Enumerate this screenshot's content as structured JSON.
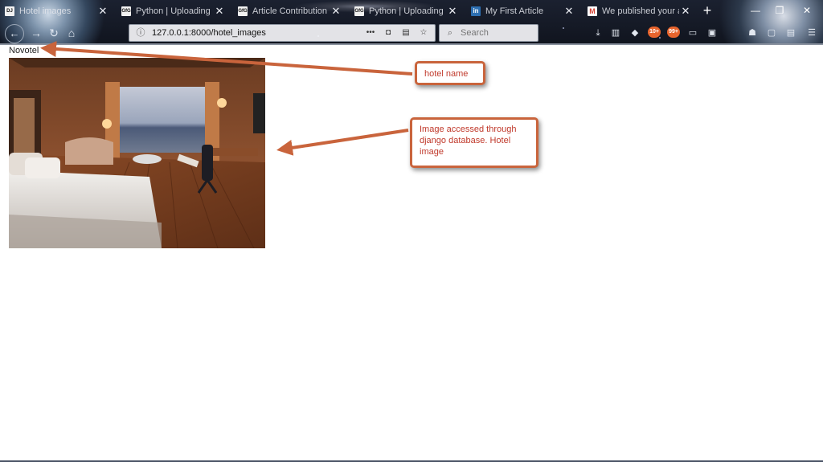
{
  "browser": {
    "tabs": [
      {
        "title": "Hotel images",
        "favicon": "django-icon",
        "favicon_text": "DJ"
      },
      {
        "title": "Python | Uploading im",
        "favicon": "gfg-icon",
        "favicon_text": "GfG"
      },
      {
        "title": "Article Contribution",
        "favicon": "gfg-icon",
        "favicon_text": "GfG"
      },
      {
        "title": "Python | Uploading i",
        "favicon": "gfg-icon",
        "favicon_text": "GfG"
      },
      {
        "title": "My First Article",
        "favicon": "linkedin-icon",
        "favicon_text": "in"
      },
      {
        "title": "We published your arti",
        "favicon": "gmail-icon",
        "favicon_text": "M"
      }
    ],
    "new_tab": "+",
    "url": "127.0.0.1:8000/hotel_images",
    "search_placeholder": "Search",
    "badges": [
      "10+",
      "99+"
    ],
    "icons": {
      "back": "back-arrow-icon",
      "home": "home-icon",
      "info": "info-icon",
      "page_actions": "ellipsis-icon",
      "pocket": "pocket-icon",
      "reader": "reader-view-icon",
      "bookmark": "bookmark-star-icon",
      "menu": "hamburger-menu-icon"
    }
  },
  "page": {
    "hotel_name": "Novotel",
    "hotel_image_alt": "Hotel room with bed, sofa and window view"
  },
  "annotations": {
    "name_label": "hotel name",
    "image_label": "Image accessed through django database. Hotel image",
    "color": "#c9643c"
  }
}
